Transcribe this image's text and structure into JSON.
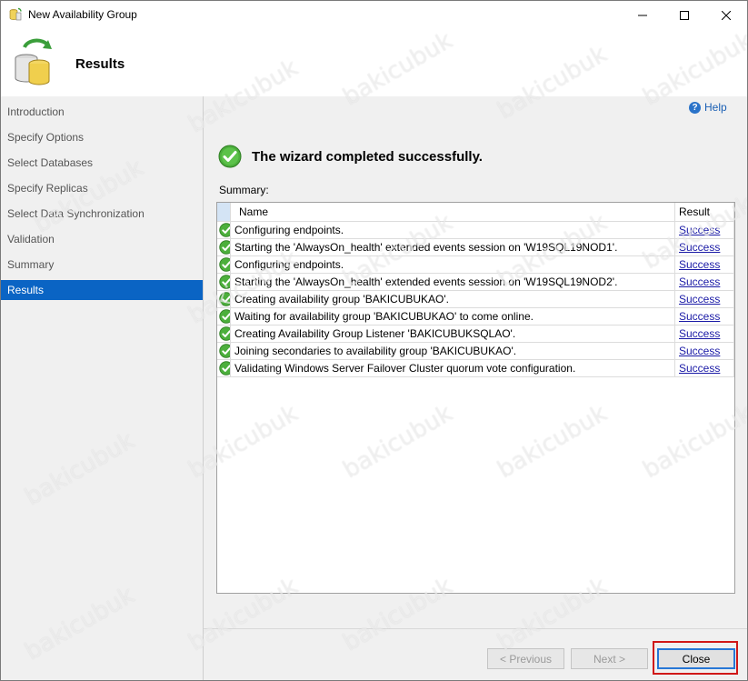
{
  "window": {
    "title": "New Availability Group",
    "icons": {
      "app": "database-wizard-icon",
      "minimize": "minimize-icon",
      "maximize": "maximize-icon",
      "close": "close-icon"
    }
  },
  "header": {
    "title": "Results",
    "icon": "availability-group-database-icon"
  },
  "nav": {
    "items": [
      {
        "label": "Introduction"
      },
      {
        "label": "Specify Options"
      },
      {
        "label": "Select Databases"
      },
      {
        "label": "Specify Replicas"
      },
      {
        "label": "Select Data Synchronization"
      },
      {
        "label": "Validation"
      },
      {
        "label": "Summary"
      },
      {
        "label": "Results"
      }
    ],
    "active_index": 7
  },
  "help": {
    "label": "Help",
    "icon": "help-icon"
  },
  "status": {
    "text": "The wizard completed successfully.",
    "icon": "success-check-icon"
  },
  "summary": {
    "label": "Summary:",
    "columns": {
      "name": "Name",
      "result": "Result"
    },
    "rows": [
      {
        "name": "Configuring endpoints.",
        "result": "Success"
      },
      {
        "name": "Starting the 'AlwaysOn_health' extended events session on 'W19SQL19NOD1'.",
        "result": "Success"
      },
      {
        "name": "Configuring endpoints.",
        "result": "Success"
      },
      {
        "name": "Starting the 'AlwaysOn_health' extended events session on 'W19SQL19NOD2'.",
        "result": "Success"
      },
      {
        "name": "Creating availability group 'BAKICUBUKAO'.",
        "result": "Success"
      },
      {
        "name": "Waiting for availability group 'BAKICUBUKAO' to come online.",
        "result": "Success"
      },
      {
        "name": "Creating Availability Group Listener 'BAKICUBUKSQLAO'.",
        "result": "Success"
      },
      {
        "name": "Joining secondaries to availability group 'BAKICUBUKAO'.",
        "result": "Success"
      },
      {
        "name": "Validating Windows Server Failover Cluster quorum vote configuration.",
        "result": "Success"
      }
    ]
  },
  "footer": {
    "previous_label": "< Previous",
    "next_label": "Next >",
    "close_label": "Close"
  },
  "watermark": "bakicubuk",
  "colors": {
    "accent": "#0a64c4",
    "success": "#4caf3c",
    "highlight": "#d01818"
  }
}
